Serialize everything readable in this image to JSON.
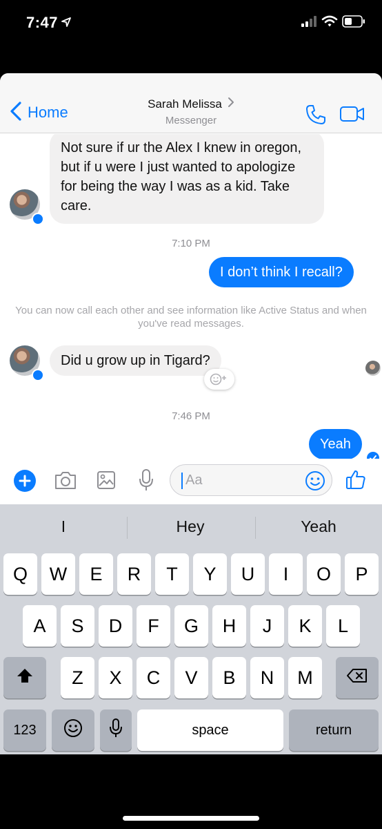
{
  "status_bar": {
    "time": "7:47",
    "icons": [
      "location-arrow-icon",
      "signal-icon",
      "wifi-icon",
      "battery-icon"
    ]
  },
  "header": {
    "back_label": "Home",
    "contact_name": "Sarah Melissa",
    "subtitle": "Messenger",
    "icons": [
      "chevron-left-icon",
      "chevron-right-icon",
      "phone-icon",
      "video-icon"
    ]
  },
  "chat": {
    "messages": [
      {
        "direction": "incoming",
        "text": "Not sure if ur the Alex I knew in oregon, but if u were I just wanted to apologize for being the way I was as a kid. Take care."
      },
      {
        "direction": "outgoing",
        "text": "I don’t think I recall?"
      },
      {
        "direction": "incoming",
        "text": "Did u grow up in Tigard?"
      },
      {
        "direction": "outgoing",
        "text": "Yeah"
      }
    ],
    "timestamps": [
      "7:10 PM",
      "7:46 PM"
    ],
    "system_note": "You can now call each other and see information like Active Status and when you've read messages."
  },
  "composer": {
    "placeholder": "Aa",
    "icons": [
      "plus-icon",
      "camera-icon",
      "photo-icon",
      "microphone-icon",
      "emoji-icon",
      "thumbs-up-icon"
    ]
  },
  "keyboard": {
    "suggestions": [
      "I",
      "Hey",
      "Yeah"
    ],
    "rows": [
      [
        "Q",
        "W",
        "E",
        "R",
        "T",
        "Y",
        "U",
        "I",
        "O",
        "P"
      ],
      [
        "A",
        "S",
        "D",
        "F",
        "G",
        "H",
        "J",
        "K",
        "L"
      ],
      [
        "Z",
        "X",
        "C",
        "V",
        "B",
        "N",
        "M"
      ]
    ],
    "numbers_label": "123",
    "space_label": "space",
    "return_label": "return"
  },
  "colors": {
    "accent": "#0a7cff",
    "incoming_bubble": "#f1f0f0",
    "keyboard_bg": "#d1d4da"
  }
}
